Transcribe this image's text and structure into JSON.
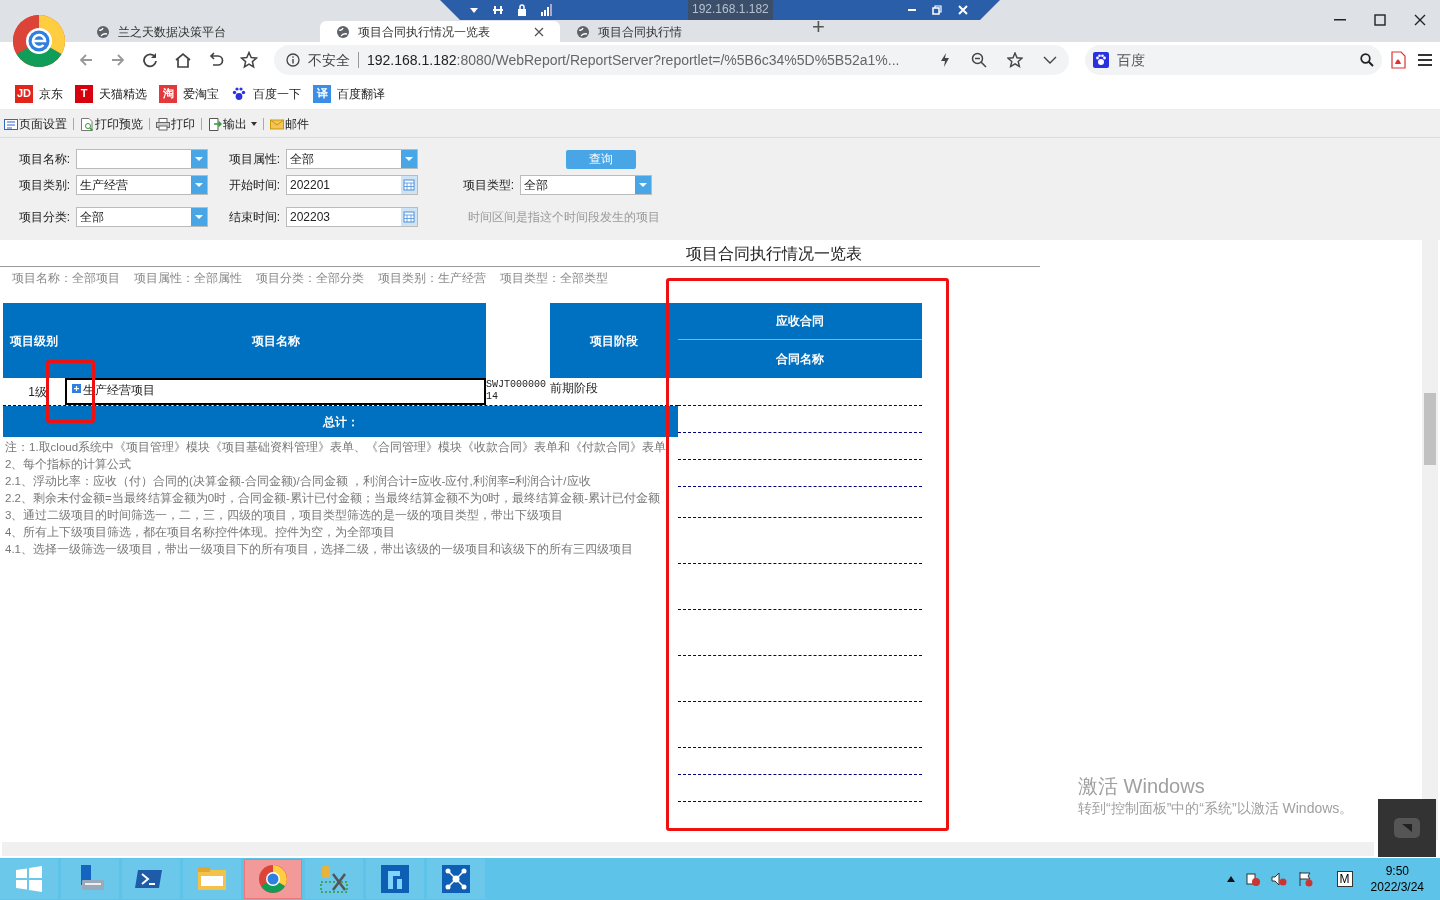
{
  "browser": {
    "tabs": [
      {
        "title": "兰之天数据决策平台",
        "selected": false
      },
      {
        "title": "项目合同执行情况一览表",
        "selected": true
      },
      {
        "title": "项目合同执行情",
        "selected": false
      }
    ],
    "new_tab": "+",
    "security": "不安全",
    "url_host": "192.168.1.182",
    "url_rest": ":8080/WebReport/ReportServer?reportlet=/%5B6c34%5D%5B52a1%...",
    "search_engine": "百度"
  },
  "remote_bar": {
    "host": "192.168.1.182"
  },
  "bookmarks": [
    {
      "kind": "badge",
      "badge": "JD",
      "label": "京东",
      "color": "#e1251b"
    },
    {
      "kind": "badge",
      "badge": "T",
      "label": "天猫精选",
      "color": "#d7000f"
    },
    {
      "kind": "badge",
      "badge": "淘",
      "label": "爱淘宝",
      "color": "#e4393c"
    },
    {
      "kind": "paw",
      "label": "百度一下",
      "color": "#2932e1"
    },
    {
      "kind": "badge",
      "badge": "译",
      "label": "百度翻译",
      "color": "#3a8ee6"
    }
  ],
  "report_toolbar": [
    {
      "label": "页面设置",
      "dropdown": false
    },
    {
      "label": "打印预览",
      "dropdown": false
    },
    {
      "label": "打印",
      "dropdown": false
    },
    {
      "label": "输出",
      "dropdown": true
    },
    {
      "label": "邮件",
      "dropdown": false
    }
  ],
  "filter_rows": [
    [
      {
        "kind": "dropdown",
        "label": "项目名称:"
      },
      {
        "kind": "dropdown",
        "label": "项目属性:",
        "value": "全部"
      },
      {
        "kind": "button",
        "label": "查询"
      }
    ],
    [
      {
        "kind": "dropdown",
        "label": "项目类别:",
        "value": "生产经营"
      },
      {
        "kind": "date",
        "label": "开始时间:",
        "value": "202201"
      },
      {
        "kind": "dropdown",
        "label": "项目类型:",
        "value": "全部"
      }
    ],
    [
      {
        "kind": "dropdown",
        "label": "项目分类:",
        "value": "全部"
      },
      {
        "kind": "date",
        "label": "结束时间:",
        "value": "202203"
      },
      {
        "kind": "hint",
        "label": "时间区间是指这个时间段发生的项目"
      }
    ]
  ],
  "report": {
    "title": "项目合同执行情况一览表",
    "summary": [
      "项目名称：全部项目",
      "项目属性：全部属性",
      "项目分类：全部分类",
      "项目类别：生产经营",
      "项目类型：全部类型"
    ],
    "columns": [
      "项目级别",
      "项目名称",
      "项目阶段"
    ],
    "group": {
      "title": "应收合同",
      "columns": [
        "合同名称"
      ]
    },
    "rows": [
      {
        "level": "1级",
        "name": "生产经营项目",
        "expanded": false,
        "code": "SWJT00000014",
        "stage": "前期阶段"
      }
    ],
    "total_label": "总计：",
    "notes": [
      "注：1.取cloud系统中《项目管理》模块《项目基础资料管理》表单、《合同管理》模块《收款合同》表单和《付款合同》表单",
      "2、每个指标的计算公式",
      "2.1、浮动比率：应收（付）合同的(决算金额-合同金额)/合同金额 ，利润合计=应收-应付,利润率=利润合计/应收",
      "2.2、剩余未付金额=当最终结算金额为0时，合同金额-累计已付金额；当最终结算金额不为0时，最终结算金额-累计已付金额",
      "3、通过二级项目的时间筛选一，二，三，四级的项目，项目类型筛选的是一级的项目类型，带出下级项目",
      "4、所有上下级项目筛选，都在项目名称控件体现。控件为空，为全部项目",
      "4.1、选择一级筛选一级项目，带出一级项目下的所有项目，选择二级，带出该级的一级项目和该级下的所有三四级项目"
    ]
  },
  "activation_notice": {
    "title": "激活 Windows",
    "text": "转到“控制面板”中的“系统”以激活 Windows。"
  },
  "taskbar": {
    "apps": [
      {
        "selected": false
      },
      {
        "selected": false
      },
      {
        "selected": false
      },
      {
        "selected": false
      },
      {
        "selected": true
      },
      {
        "selected": false
      },
      {
        "selected": false
      },
      {
        "selected": false
      }
    ],
    "ime": "M",
    "time": "9:50",
    "date": "2022/3/24"
  }
}
